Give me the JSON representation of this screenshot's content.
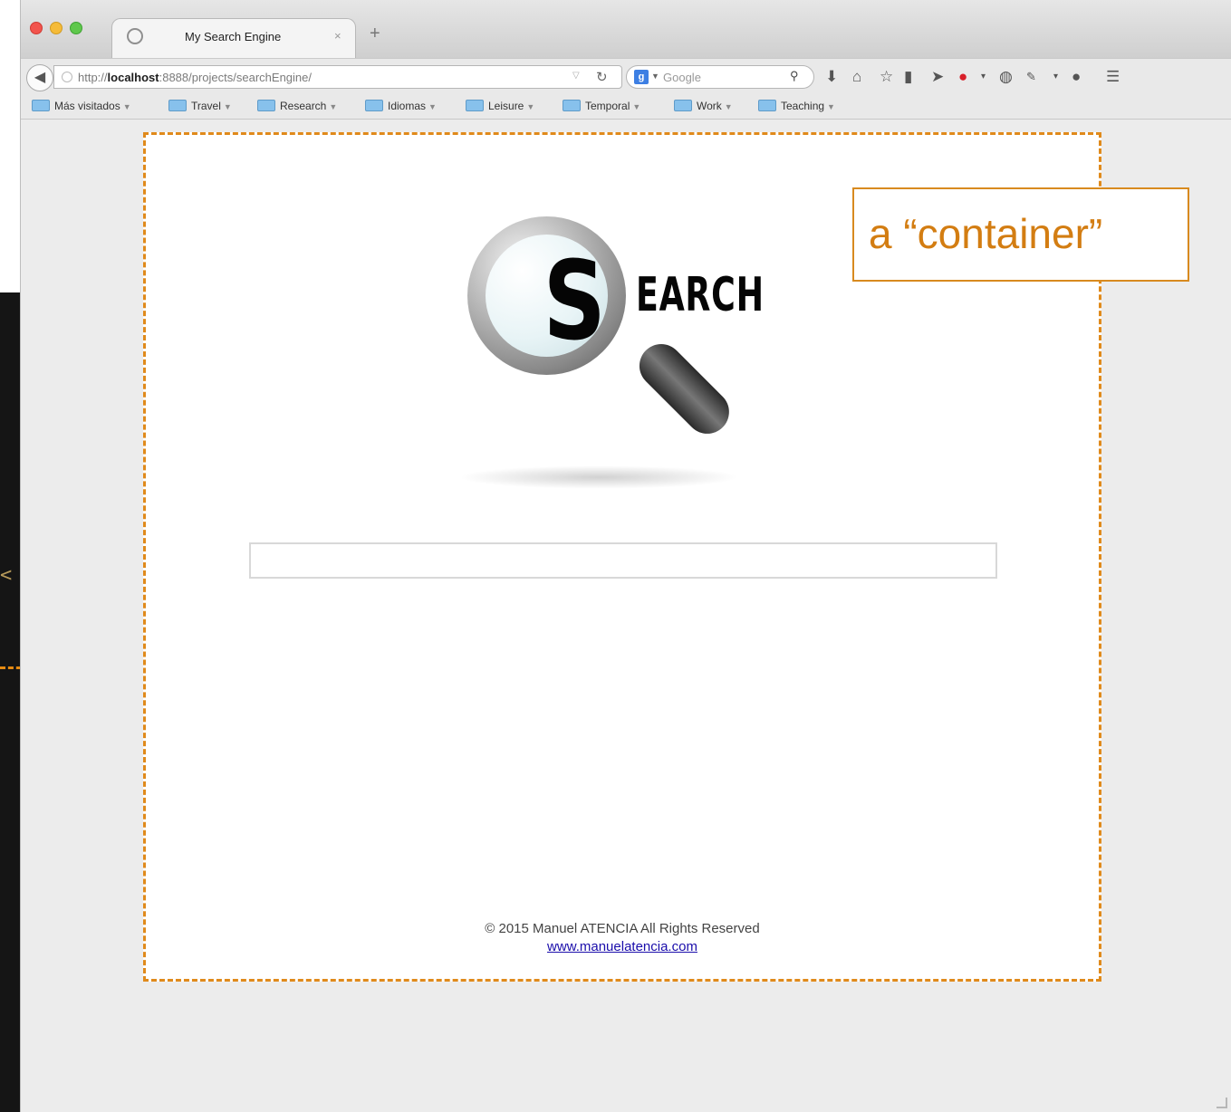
{
  "editor": {
    "fragment_1": "<",
    "fragment_2": "/>"
  },
  "browser": {
    "tab": {
      "title": "My Search Engine",
      "close": "×"
    },
    "new_tab": "+",
    "url": {
      "prefix": "http://",
      "host": "localhost",
      "rest": ":8888/projects/searchEngine/"
    },
    "search": {
      "engine_badge": "g",
      "placeholder": "Google"
    },
    "bookmarks": [
      {
        "label": "Más visitados"
      },
      {
        "label": "Travel"
      },
      {
        "label": "Research"
      },
      {
        "label": "Idiomas"
      },
      {
        "label": "Leisure"
      },
      {
        "label": "Temporal"
      },
      {
        "label": "Work"
      },
      {
        "label": "Teaching"
      }
    ]
  },
  "page": {
    "logo": {
      "s": "S",
      "rest": "EARCH"
    },
    "search_input": {
      "value": "",
      "placeholder": ""
    },
    "footer": {
      "copyright": "© 2015 Manuel ATENCIA All Rights Reserved",
      "link": "www.manuelatencia.com"
    }
  },
  "annotation": {
    "text": "a “container”"
  },
  "colors": {
    "dashed_border": "#e08a1b",
    "annotation_text": "#d37d12",
    "link": "#1a0dab"
  }
}
